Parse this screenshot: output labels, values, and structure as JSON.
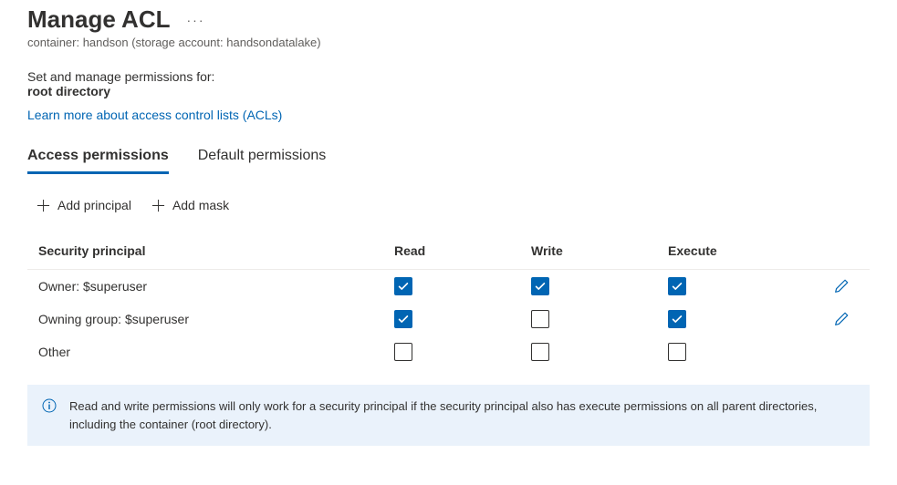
{
  "header": {
    "title": "Manage ACL",
    "subtitle": "container: handson (storage account: handsondatalake)"
  },
  "intro": {
    "line1": "Set and manage permissions for:",
    "line2": "root directory"
  },
  "learn_more": "Learn more about access control lists (ACLs)",
  "tabs": [
    {
      "label": "Access permissions",
      "active": true
    },
    {
      "label": "Default permissions",
      "active": false
    }
  ],
  "toolbar": {
    "add_principal": "Add principal",
    "add_mask": "Add mask"
  },
  "columns": {
    "principal": "Security principal",
    "read": "Read",
    "write": "Write",
    "execute": "Execute"
  },
  "rows": [
    {
      "principal": "Owner: $superuser",
      "read": true,
      "write": true,
      "execute": true,
      "editable": true
    },
    {
      "principal": "Owning group: $superuser",
      "read": true,
      "write": false,
      "execute": true,
      "editable": true
    },
    {
      "principal": "Other",
      "read": false,
      "write": false,
      "execute": false,
      "editable": false
    }
  ],
  "info": "Read and write permissions will only work for a security principal if the security principal also has execute permissions on all parent directories, including the container (root directory)."
}
